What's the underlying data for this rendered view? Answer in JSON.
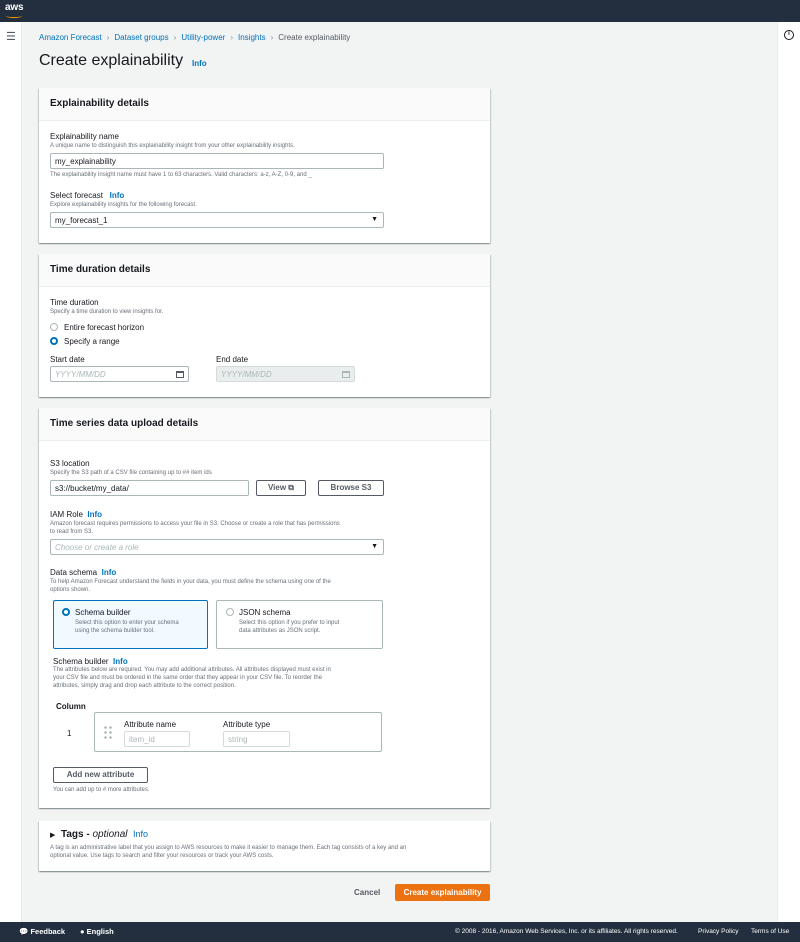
{
  "topbar": {
    "logo": "aws"
  },
  "breadcrumb": [
    "Amazon Forecast",
    "Dataset groups",
    "Utility-power",
    "Insights",
    "Create explainability"
  ],
  "page_title": "Create explainability",
  "info": "Info",
  "explainability_details": {
    "heading": "Explainability details",
    "name_label": "Explainability name",
    "name_desc": "A unique name to distinguish this explainability insight from your other explainability insights.",
    "name_value": "my_explainability",
    "name_constraint": "The explainability insight name must have 1 to 63 characters. Valid characters: a-z, A-Z, 0-9, and _",
    "forecast_label": "Select forecast",
    "forecast_desc": "Explore explainability insights for the following forecast.",
    "forecast_value": "my_forecast_1"
  },
  "time_duration": {
    "heading": "Time duration details",
    "label": "Time duration",
    "desc": "Specify a time duration to view insights for.",
    "option_entire": "Entire forecast horizon",
    "option_range": "Specify a range",
    "selected": "Specify a range",
    "start_label": "Start date",
    "start_placeholder": "YYYY/MM/DD",
    "end_label": "End date",
    "end_placeholder": "YYYY/MM/DD"
  },
  "upload": {
    "heading": "Time series data upload details",
    "s3_label": "S3 location",
    "s3_desc": "Specify the S3 path of a CSV file containing up to ## item ids",
    "s3_value": "s3://bucket/my_data/",
    "view_button": "View",
    "browse_button": "Browse S3",
    "iam_label": "IAM Role",
    "iam_desc_1": "Amazon forecast requires permissions to access your file in S3. Choose or create a role that has permissions",
    "iam_desc_2": "to read from S3.",
    "iam_placeholder": "Choose or create a role",
    "schema_label": "Data schema",
    "schema_desc_1": "To help Amazon Forecast understand the fields in your data, you must define the schema using one of the",
    "schema_desc_2": "options shown.",
    "schema_builder_title": "Schema builder",
    "schema_builder_desc_1": "Select this option to enter your schema",
    "schema_builder_desc_2": "using the schema builder tool.",
    "json_schema_title": "JSON schema",
    "json_schema_desc_1": "Select this option if you prefer to input",
    "json_schema_desc_2": "data attributes as JSON script.",
    "builder_label": "Schema builder",
    "builder_desc_1": "The attributes below are required. You may add additional attributes. All attributes displayed must exist in",
    "builder_desc_2": "your CSV file and must be ordered in the same order that they appear in your CSV file. To reorder the",
    "builder_desc_3": "attributes, simply drag and drop each attribute to the correct position.",
    "column_header": "Column",
    "row_number": "1",
    "attr_name_header": "Attribute name",
    "attr_type_header": "Attribute type",
    "attr_name_placeholder": "item_id",
    "attr_type_placeholder": "string",
    "add_attribute_button": "Add new attribute",
    "add_hint": "You can add up to # more attributes."
  },
  "tags": {
    "title": "Tags -",
    "optional": "optional",
    "desc_1": "A tag is an administrative label that you assign to AWS resources to make it easier to manage them. Each tag consists of a key and an",
    "desc_2": "optional value. Use tags to search and filter your resources or track your AWS costs."
  },
  "actions": {
    "cancel": "Cancel",
    "create": "Create explainability"
  },
  "footer": {
    "feedback": "Feedback",
    "language": "English",
    "copyright": "© 2008 - 2016, Amazon Web Services, Inc. or its affiliates. All rights reserved.",
    "privacy": "Privacy Policy",
    "terms": "Terms of Use"
  },
  "colors": {
    "accent": "#0073bb",
    "primary_button": "#ec7211",
    "topbar": "#232f3e"
  }
}
